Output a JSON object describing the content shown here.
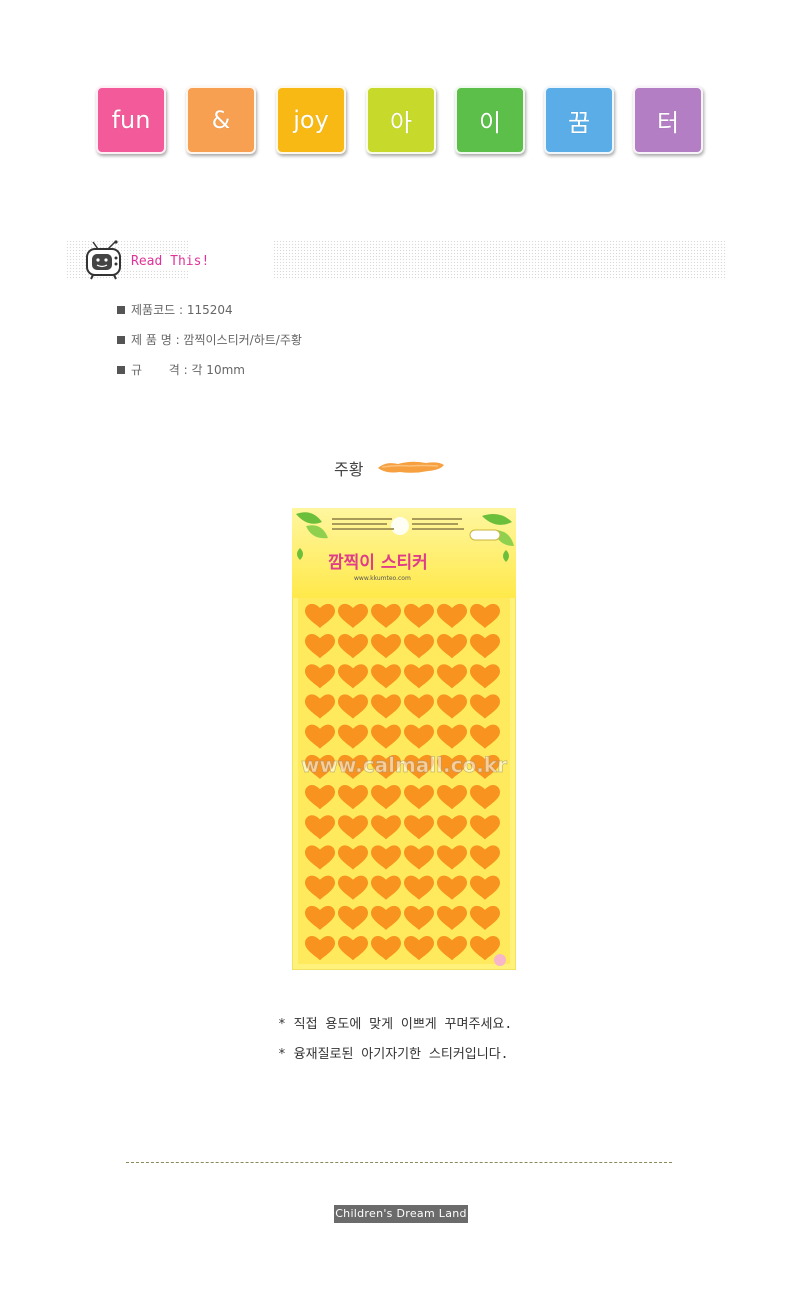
{
  "tiles": [
    {
      "label": "fun",
      "color": "#f25a9a"
    },
    {
      "label": "&",
      "color": "#f7a052"
    },
    {
      "label": "joy",
      "color": "#f8b914"
    },
    {
      "label": "아",
      "color": "#c7d92a"
    },
    {
      "label": "이",
      "color": "#5cbf4a"
    },
    {
      "label": "꿈",
      "color": "#5aade6"
    },
    {
      "label": "터",
      "color": "#b47ec4"
    }
  ],
  "read_this": {
    "label": "Read This!"
  },
  "info": {
    "code": "제품코드 : 115204",
    "name": "제 품 명 : 깜찍이스티커/하트/주황",
    "size": "규       격 : 각 10mm"
  },
  "color_option": {
    "name": "주황",
    "swatch_color": "#f6a040"
  },
  "product": {
    "title": "깜찍이 스티커",
    "url": "www.kkumteo.com",
    "watermark": "www.calmall.co.kr",
    "sticker_color": "#f7931e",
    "rows": 12,
    "cols": 6
  },
  "notes": [
    "* 직접 용도에 맞게 이쁘게 꾸며주세요.",
    "* 융재질로된 아기자기한 스티커입니다."
  ],
  "footer": {
    "label": "Children's Dream Land"
  }
}
